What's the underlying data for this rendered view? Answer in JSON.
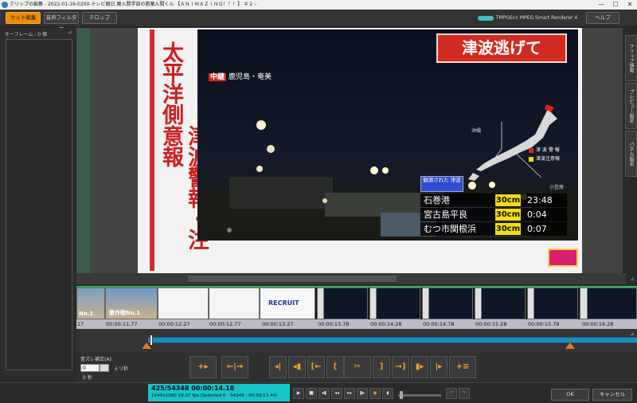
{
  "window": {
    "title": "クリップの編集 - 2022-01-16-0200-テレビ朝日 魔入間学部の悪魔入間くん 【ＡＮｉＭＡＺｉＮＧ！！！】 ＃２ -",
    "controls": [
      "—",
      "☐",
      "✕"
    ]
  },
  "toolbar": {
    "cut_edit": "カット編集",
    "audio_filter": "音声フィルター",
    "telop": "テロップ",
    "brand": "TMPGEnc MPEG Smart Renderer 4",
    "help": "ヘルプ"
  },
  "keyframe": {
    "label": "キーフレーム : 0 個"
  },
  "preview": {
    "vertical_caption_1": "太平洋側",
    "vertical_caption_2": "津波警報・注意報",
    "big_caption": "津波逃げて",
    "location_tag": "中継",
    "location": "鹿児島・奄美",
    "map_label_okinawa": "沖縄",
    "map_label_ogasawara": "小笠原",
    "legend": [
      {
        "label": "津 波 警 報",
        "color": "#e02020"
      },
      {
        "label": "津波注意報",
        "color": "#f4dc10"
      }
    ],
    "observed_header": "観測された 津波",
    "tsunami_rows": [
      {
        "place": "石巻港",
        "height": "30cm",
        "time": "23:48"
      },
      {
        "place": "宮古島平良",
        "height": "30cm",
        "time": "0:04"
      },
      {
        "place": "むつ市関根浜",
        "height": "30cm",
        "time": "0:07"
      }
    ]
  },
  "right_tabs": [
    "クリップ情報",
    "プレビュー設定",
    "パネル設定"
  ],
  "timeline": {
    "timecodes": [
      "27",
      "00:00:11.77",
      "00:00:12.27",
      "00:00:12.77",
      "00:00:13.27",
      "00:00:13.78",
      "00:00:14.28",
      "00:00:14.78",
      "00:00:15.28",
      "00:00:15.78",
      "00:00:16.28"
    ],
    "thumb_text": [
      "No.1",
      "業作戦No.1",
      "",
      "",
      "RECRUIT",
      "",
      "",
      "",
      "",
      "",
      ""
    ]
  },
  "offset": {
    "label": "音ズレ補正(A):",
    "value": "0",
    "unit": "ミリ秒",
    "seconds": "0 秒"
  },
  "status": {
    "frame": "425/54348 00:00:14.18",
    "info": "1440x1080 29.97 fps (Selected 0 - 54348 : 00:30:13.44)",
    "ok": "OK",
    "cancel": "キャンセル"
  }
}
